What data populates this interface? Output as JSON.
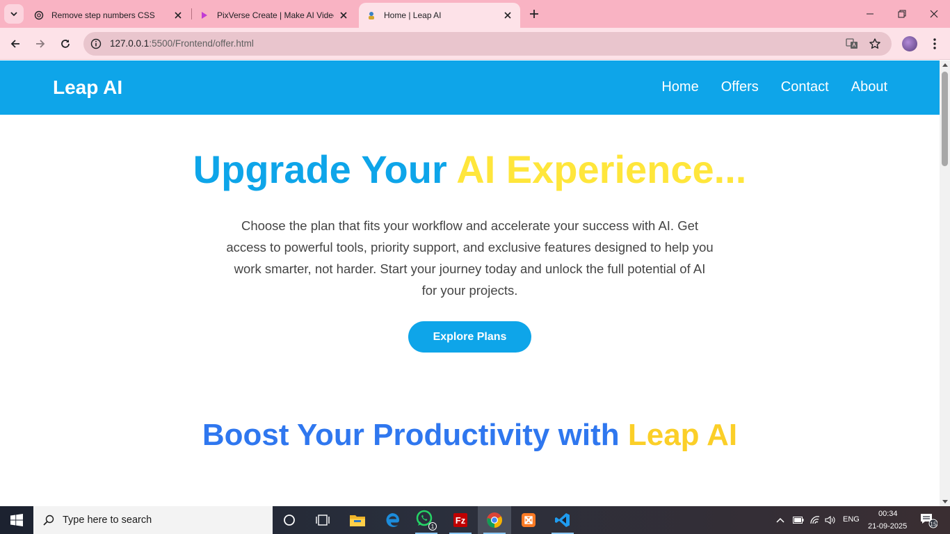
{
  "browser": {
    "tabs": [
      {
        "title": "Remove step numbers CSS",
        "icon": "chatgpt-icon",
        "active": false
      },
      {
        "title": "PixVerse Create | Make AI Video",
        "icon": "pixverse-icon",
        "active": false
      },
      {
        "title": "Home | Leap AI",
        "icon": "leap-ai-favicon",
        "active": true
      }
    ],
    "url_host": "127.0.0.1",
    "url_path": ":5500/Frontend/offer.html",
    "theme": {
      "tabbar": "#f9b3c3",
      "toolbar": "#fde2e8",
      "omnibox": "#e9c5cd"
    }
  },
  "site": {
    "brand": "Leap AI",
    "nav": [
      "Home",
      "Offers",
      "Contact",
      "About"
    ],
    "hero": {
      "title_part1": "Upgrade Your",
      "title_part2": "AI Experience...",
      "description": "Choose the plan that fits your workflow and accelerate your success with AI. Get access to powerful tools, priority support, and exclusive features designed to help you work smarter, not harder. Start your journey today and unlock the full potential of AI for your projects.",
      "cta": "Explore Plans"
    },
    "section": {
      "title_part1": "Boost Your Productivity with",
      "title_part2": "Leap AI"
    },
    "colors": {
      "primary": "#0ea5e9",
      "accent_yellow": "#ffe63b",
      "royal_blue": "#2f77ef",
      "gold": "#fbcf28"
    }
  },
  "taskbar": {
    "search_placeholder": "Type here to search",
    "apps": [
      "cortana-icon",
      "task-view-icon",
      "file-explorer-icon",
      "edge-icon",
      "whatsapp-icon",
      "filezilla-icon",
      "chrome-icon",
      "xampp-icon",
      "vscode-icon"
    ],
    "whatsapp_badge": "1",
    "language": "ENG",
    "time": "00:34",
    "date": "21-09-2025",
    "notifications": "15"
  }
}
